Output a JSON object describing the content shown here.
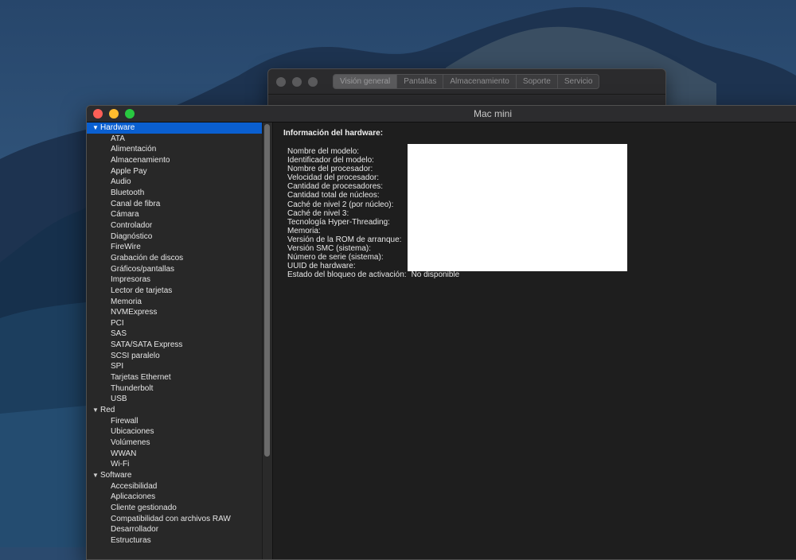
{
  "about_window": {
    "tabs": [
      {
        "label": "Visión general",
        "active": true
      },
      {
        "label": "Pantallas",
        "active": false
      },
      {
        "label": "Almacenamiento",
        "active": false
      },
      {
        "label": "Soporte",
        "active": false
      },
      {
        "label": "Servicio",
        "active": false
      }
    ]
  },
  "window": {
    "title": "Mac mini"
  },
  "sidebar": {
    "categories": [
      {
        "label": "Hardware",
        "selected": true,
        "items": [
          "ATA",
          "Alimentación",
          "Almacenamiento",
          "Apple Pay",
          "Audio",
          "Bluetooth",
          "Canal de fibra",
          "Cámara",
          "Controlador",
          "Diagnóstico",
          "FireWire",
          "Grabación de discos",
          "Gráficos/pantallas",
          "Impresoras",
          "Lector de tarjetas",
          "Memoria",
          "NVMExpress",
          "PCI",
          "SAS",
          "SATA/SATA Express",
          "SCSI paralelo",
          "SPI",
          "Tarjetas Ethernet",
          "Thunderbolt",
          "USB"
        ]
      },
      {
        "label": "Red",
        "selected": false,
        "items": [
          "Firewall",
          "Ubicaciones",
          "Volúmenes",
          "WWAN",
          "Wi-Fi"
        ]
      },
      {
        "label": "Software",
        "selected": false,
        "items": [
          "Accesibilidad",
          "Aplicaciones",
          "Cliente gestionado",
          "Compatibilidad con archivos RAW",
          "Desarrollador",
          "Estructuras"
        ]
      }
    ]
  },
  "content": {
    "section_title": "Información del hardware:",
    "properties": [
      {
        "label": "Nombre del modelo:",
        "value": ""
      },
      {
        "label": "Identificador del modelo:",
        "value": ""
      },
      {
        "label": "Nombre del procesador:",
        "value": ""
      },
      {
        "label": "Velocidad del procesador:",
        "value": ""
      },
      {
        "label": "Cantidad de procesadores:",
        "value": ""
      },
      {
        "label": "Cantidad total de núcleos:",
        "value": ""
      },
      {
        "label": "Caché de nivel 2 (por núcleo):",
        "value": ""
      },
      {
        "label": "Caché de nivel 3:",
        "value": ""
      },
      {
        "label": "Tecnología Hyper-Threading:",
        "value": ""
      },
      {
        "label": "Memoria:",
        "value": ""
      },
      {
        "label": "Versión de la ROM de arranque:",
        "value": ""
      },
      {
        "label": "Versión SMC (sistema):",
        "value": ""
      },
      {
        "label": "Número de serie (sistema):",
        "value": ""
      },
      {
        "label": "UUID de hardware:",
        "value": ""
      },
      {
        "label": "Estado del bloqueo de activación:",
        "value": "No disponible"
      }
    ]
  },
  "colors": {
    "selection": "#0a5fd0",
    "close": "#fe5f57",
    "minimize": "#febc2e",
    "maximize": "#28c840"
  }
}
